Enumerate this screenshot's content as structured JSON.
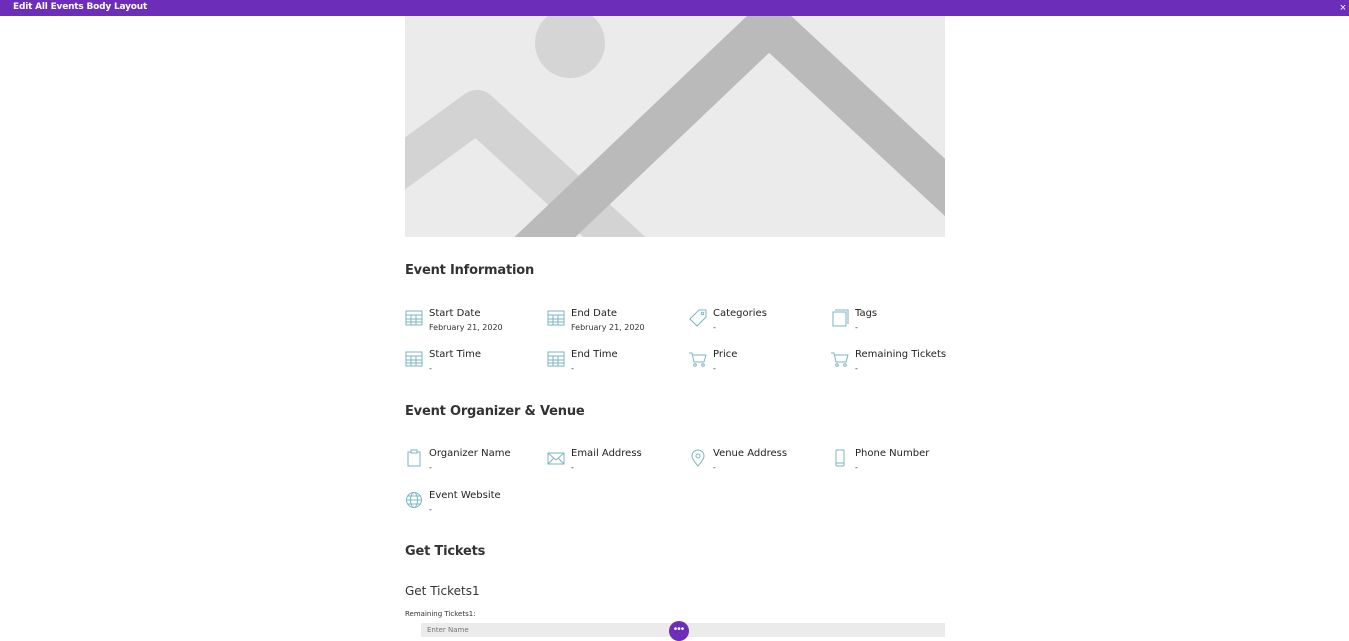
{
  "topbar": {
    "title": "Edit All Events Body Layout",
    "close_glyph": "×"
  },
  "hero": {
    "icon": "image-placeholder-icon"
  },
  "event_info": {
    "title": "Event Information",
    "items": [
      {
        "label": "Start Date",
        "value": "February 21, 2020",
        "icon": "calendar-icon"
      },
      {
        "label": "End Date",
        "value": "February 21, 2020",
        "icon": "calendar-icon"
      },
      {
        "label": "Categories",
        "value": "-",
        "icon": "tag-icon"
      },
      {
        "label": "Tags",
        "value": "-",
        "icon": "tags-icon"
      },
      {
        "label": "Start Time",
        "value": "-",
        "icon": "calendar-icon"
      },
      {
        "label": "End Time",
        "value": "-",
        "icon": "calendar-icon"
      },
      {
        "label": "Price",
        "value": "-",
        "icon": "cart-icon"
      },
      {
        "label": "Remaining Tickets",
        "value": "-",
        "icon": "cart-icon"
      }
    ]
  },
  "organizer": {
    "title": "Event Organizer & Venue",
    "items": [
      {
        "label": "Organizer Name",
        "value": "-",
        "icon": "clipboard-icon"
      },
      {
        "label": "Email Address",
        "value": "-",
        "icon": "envelope-icon"
      },
      {
        "label": "Venue Address",
        "value": "-",
        "icon": "map-pin-icon"
      },
      {
        "label": "Phone Number",
        "value": "-",
        "icon": "phone-icon"
      },
      {
        "label": "Event Website",
        "value": "-",
        "icon": "globe-icon"
      }
    ]
  },
  "tickets": {
    "title": "Get Tickets",
    "subtitle": "Get Tickets1",
    "remaining_label": "Remaining Tickets1:",
    "name_placeholder": "Enter Name"
  },
  "fab": {
    "glyph": "•••",
    "icon": "more-icon"
  },
  "colors": {
    "accent": "#6c2eb9",
    "icon": "#7ab6bf",
    "placeholder_bg": "#ebebeb"
  }
}
